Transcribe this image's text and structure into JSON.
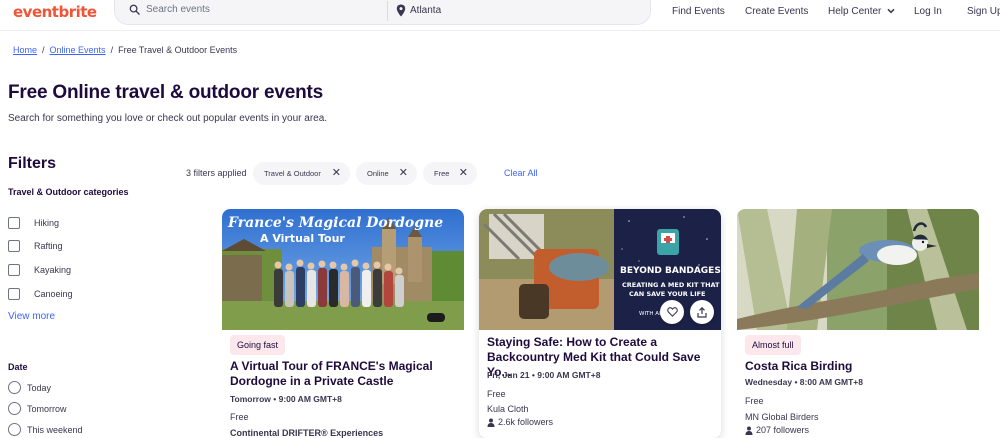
{
  "header": {
    "logo": "eventbrite",
    "search_placeholder": "Search events",
    "location": "Atlanta",
    "nav": [
      "Find Events",
      "Create Events",
      "Help Center",
      "Log In",
      "Sign Up"
    ]
  },
  "breadcrumb": {
    "home": "Home",
    "sep1": "/",
    "online": "Online Events",
    "sep2": "/",
    "current": "Free Travel & Outdoor Events"
  },
  "page": {
    "title": "Free Online travel & outdoor events",
    "subtitle": "Search for something you love or check out popular events in your area."
  },
  "filters": {
    "title": "Filters",
    "category_title": "Travel & Outdoor categories",
    "categories": [
      "Hiking",
      "Rafting",
      "Kayaking",
      "Canoeing"
    ],
    "view_more": "View more",
    "date_title": "Date",
    "dates": [
      "Today",
      "Tomorrow",
      "This weekend"
    ]
  },
  "applied": {
    "count_label": "3 filters applied",
    "chips": [
      "Travel & Outdoor",
      "Online",
      "Free"
    ],
    "clear_all": "Clear All"
  },
  "cards": [
    {
      "image_title": "France's Magical Dordogne",
      "image_subtitle": "A Virtual Tour",
      "badge": "Going fast",
      "title": "A Virtual Tour of FRANCE's Magical Dordogne in a Private Castle",
      "date": "Tomorrow • 9:00 AM GMT+8",
      "price": "Free",
      "organizer": "Continental DRIFTER® Experiences",
      "followers": ""
    },
    {
      "image_title": "BEYOND BANDAGES",
      "image_subtitle": "CREATING A MED KIT THAT CAN SAVE YOUR LIFE",
      "image_extra": "WITH AN",
      "badge": "",
      "title": "Staying Safe: How to Create a Backcountry Med Kit that Could Save Yo...",
      "date": "Fri, Jun 21 • 9:00 AM GMT+8",
      "price": "Free",
      "organizer": "Kula Cloth",
      "followers": "2.6k followers"
    },
    {
      "badge": "Almost full",
      "title": "Costa Rica Birding",
      "date": "Wednesday • 8:00 AM GMT+8",
      "price": "Free",
      "organizer": "MN Global Birders",
      "followers": "207 followers"
    }
  ],
  "colors": {
    "brand": "#f05537",
    "link": "#3d64ff",
    "text": "#1e0a3c",
    "badge_bg": "#fbe7ec"
  }
}
